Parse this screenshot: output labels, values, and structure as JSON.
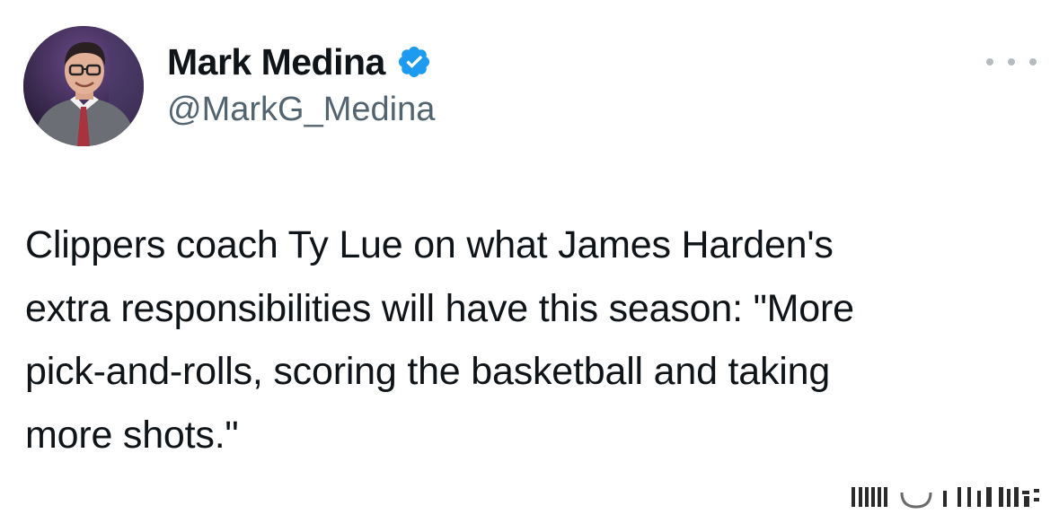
{
  "author": {
    "display_name": "Mark Medina",
    "handle": "@MarkG_Medina",
    "verified_icon": "verified-badge-icon",
    "verified_color": "#1d9bf0"
  },
  "tweet": {
    "text_lines": [
      "Clippers coach Ty Lue on what James Harden's",
      "extra responsibilities will have this season: \"More",
      "pick-and-rolls, scoring the basketball and taking",
      "more shots.\""
    ]
  },
  "colors": {
    "text": "#0f1419",
    "secondary": "#536471",
    "more_dots": "#b4bcc2"
  },
  "icons": {
    "more": "more-horizontal-icon"
  }
}
